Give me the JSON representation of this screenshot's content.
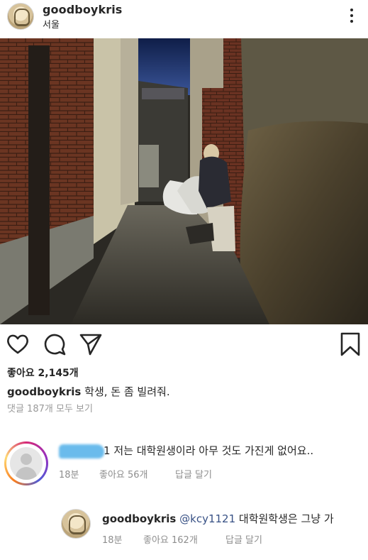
{
  "post": {
    "username": "goodboykris",
    "location": "서울",
    "likes_text": "좋아요 2,145개",
    "caption_text": "학생, 돈 좀 빌려줘.",
    "view_all_comments": "댓글 187개 모두 보기"
  },
  "comments": [
    {
      "username_redacted": true,
      "username_tail": "1",
      "text": "저는 대학원생이라 아무 것도 가진게 없어요..",
      "time": "18분",
      "likes": "좋아요 56개",
      "reply_label": "답글 달기"
    },
    {
      "username": "goodboykris",
      "mention": "@kcy1121",
      "text": "대학원학생은 그냥 가",
      "time": "18분",
      "likes": "좋아요 162개",
      "reply_label": "답글 달기"
    }
  ],
  "icons": [
    "more-vertical-icon",
    "heart-icon",
    "comment-icon",
    "share-icon",
    "bookmark-icon"
  ],
  "colors": {
    "text": "#262626",
    "secondary": "#8e8e8e",
    "mention": "#385185",
    "redaction": "#5ab4ea"
  }
}
